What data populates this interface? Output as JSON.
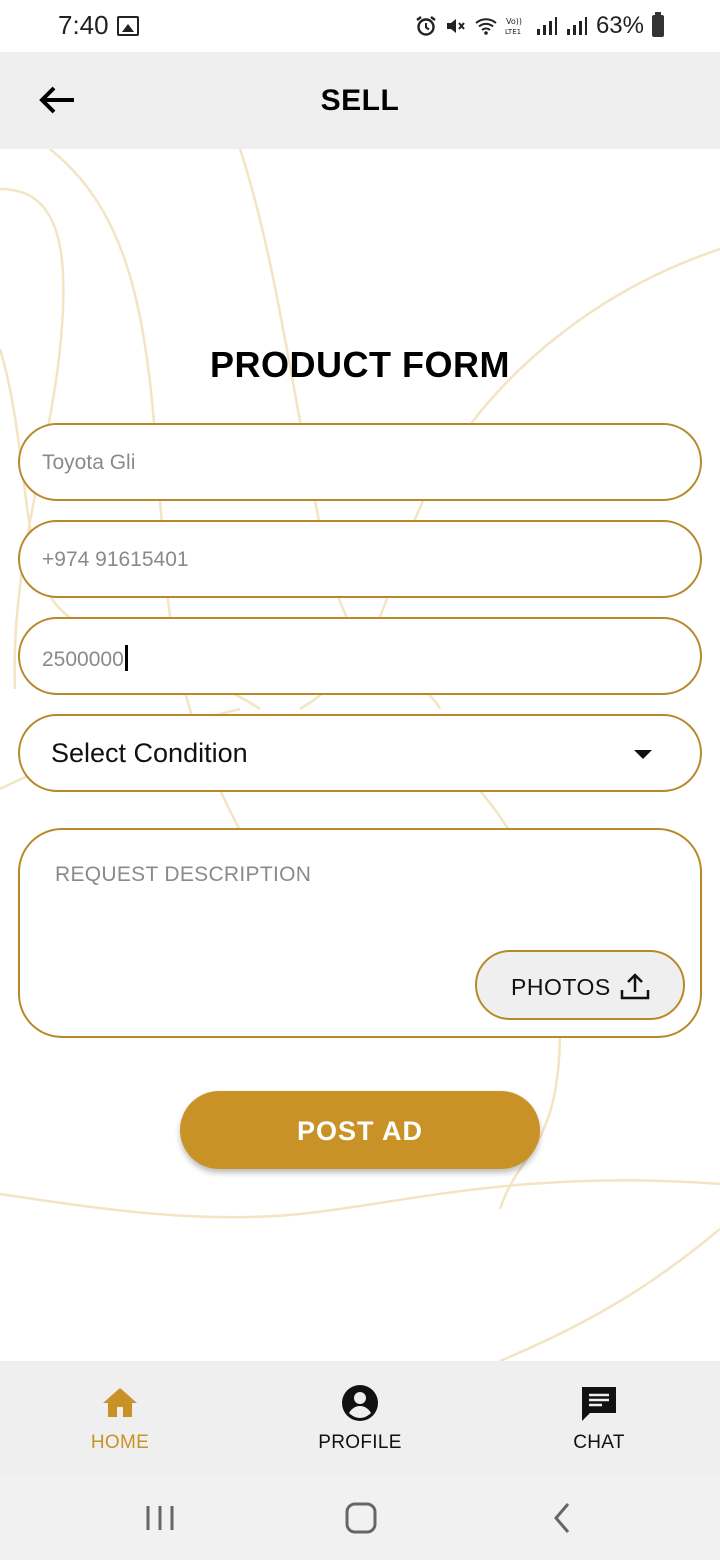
{
  "status_bar": {
    "time": "7:40",
    "battery": "63%",
    "icons": [
      "image-icon",
      "alarm-icon",
      "mute-icon",
      "wifi-icon",
      "volte-icon",
      "signal-icon",
      "signal-icon",
      "battery-icon"
    ]
  },
  "header": {
    "title": "SELL",
    "back_icon": "back-arrow-icon"
  },
  "form": {
    "title": "PRODUCT FORM",
    "product_name_value": "Toyota Gli",
    "phone_value": "+974 91615401",
    "price_value": "2500000",
    "condition_select": "Select Condition",
    "description_placeholder": "REQUEST DESCRIPTION",
    "photos_label": "PHOTOS",
    "submit_label": "POST AD"
  },
  "bottom_nav": {
    "items": [
      {
        "label": "HOME",
        "icon": "home-icon",
        "active": true
      },
      {
        "label": "PROFILE",
        "icon": "account-circle-icon",
        "active": false
      },
      {
        "label": "CHAT",
        "icon": "chat-icon",
        "active": false
      }
    ]
  },
  "system_nav": {
    "icons": [
      "recent-apps-icon",
      "home-button-icon",
      "back-icon"
    ]
  },
  "colors": {
    "accent": "#c89227",
    "field_border": "#b8892b",
    "header_bg": "#efefef",
    "decorative_curves": "#f3e4c4"
  }
}
